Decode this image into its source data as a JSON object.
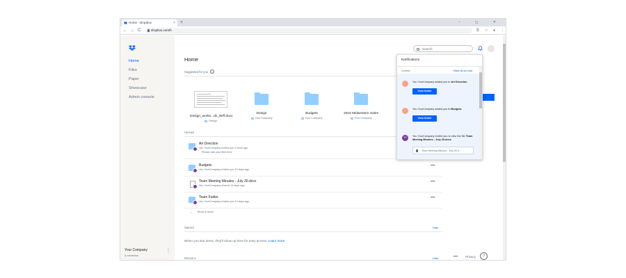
{
  "browser": {
    "tab_title": "Home - Dropbox",
    "tab_close": "×",
    "new_tab": "+",
    "window_controls": "– ◻ ✕",
    "back": "←",
    "forward": "→",
    "reload": "C",
    "url": "dropbox.com/h",
    "key_icon": "⚿",
    "star_icon": "☆",
    "account_icon": "●",
    "menu_icon": "⋮"
  },
  "sidebar": {
    "items": [
      {
        "label": "Home",
        "active": true
      },
      {
        "label": "Files",
        "active": false
      },
      {
        "label": "Paper",
        "active": false
      },
      {
        "label": "Showcase",
        "active": false
      },
      {
        "label": "Admin console",
        "active": false
      }
    ],
    "company": "Your Company",
    "members": "6 members",
    "more": "⋮"
  },
  "main": {
    "title": "Home",
    "suggested_label": "Suggested for you",
    "info": "i",
    "suggested": [
      {
        "name": "Design_works...ds_Wiff.docx",
        "sub": "Design",
        "kind": "doc"
      },
      {
        "name": "Design",
        "sub": "Your Company",
        "kind": "folder"
      },
      {
        "name": "Budgets",
        "sub": "Your Company",
        "kind": "folder"
      },
      {
        "name": "2016 Midwestern Sales",
        "sub": "Your Company",
        "kind": "folder"
      }
    ],
    "unread_label": "Unread",
    "rows": [
      {
        "name": "Art Direction",
        "sub": "You YourCompany invited you 3 mins ago",
        "sub2": "Please add your files here",
        "kind": "folder"
      },
      {
        "name": "Budgets",
        "sub": "You YourCompany invited you 13 days ago",
        "sub2": "",
        "kind": "folder"
      },
      {
        "name": "Team Meeting Minutes - July 30.docx",
        "sub": "You YourCompany shared 13 days ago",
        "sub2": "",
        "kind": "doc"
      },
      {
        "name": "Team Folder",
        "sub": "You YourCompany invited you 14 days ago",
        "sub2": "",
        "kind": "folder"
      }
    ],
    "row_dots": "•••",
    "show_more": "Show 6 more",
    "show_more_icon": "⌄",
    "starred_label": "Starred",
    "hide": "Hide",
    "starred_empty": "When you star items, they'll show up here for easy access.",
    "learn_more": "Learn more",
    "recent_label": "Recent ▾",
    "recent_hide": "Hide"
  },
  "header": {
    "search_placeholder": "Search"
  },
  "notifications": {
    "title": "Notifications",
    "unread": "Unread",
    "mark_all": "Mark all as read",
    "items": [
      {
        "pre": "You YourCompany added you to ",
        "bold": "Art Direction",
        "button": "View folder",
        "avatar_color": "#f5a38a",
        "avatar_text": ""
      },
      {
        "pre": "You YourCompany added you to ",
        "bold": "Budgets",
        "button": "View folder",
        "avatar_color": "#f5a38a",
        "avatar_text": ""
      },
      {
        "pre": "You YourCompany invited you to view the file ",
        "bold": "Team Meeting Minutes - July 30.docx",
        "file_preview": "Team Meeting Minutes - July 30.d...",
        "avatar_color": "#7b3fa0",
        "avatar_text": "YY"
      }
    ]
  },
  "footer": {
    "dots": "•••",
    "privacy": "Privacy",
    "help": "?"
  },
  "colors": {
    "accent": "#0061fe",
    "folder": "#92ceff",
    "sidebar_bg": "#f7f5f2"
  }
}
